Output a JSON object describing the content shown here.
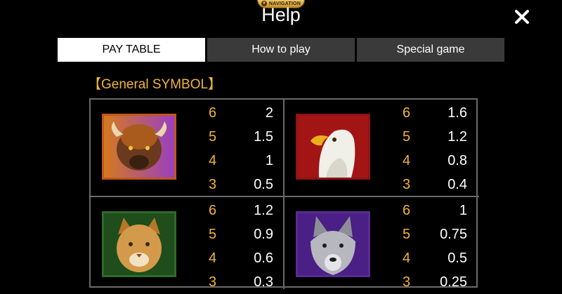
{
  "header": {
    "nav_badge": "NAVIGATION",
    "title": "Help",
    "close_symbol": "✕"
  },
  "tabs": [
    {
      "label": "PAY TABLE",
      "active": true
    },
    {
      "label": "How to play",
      "active": false
    },
    {
      "label": "Special game",
      "active": false
    }
  ],
  "section": {
    "title": "【General SYMBOL】"
  },
  "symbols": [
    {
      "icon": "bison-icon",
      "frame_color": "#c2561c",
      "pays": [
        {
          "count": "6",
          "value": "2"
        },
        {
          "count": "5",
          "value": "1.5"
        },
        {
          "count": "4",
          "value": "1"
        },
        {
          "count": "3",
          "value": "0.5"
        }
      ]
    },
    {
      "icon": "eagle-icon",
      "frame_color": "#8e1414",
      "pays": [
        {
          "count": "6",
          "value": "1.6"
        },
        {
          "count": "5",
          "value": "1.2"
        },
        {
          "count": "4",
          "value": "0.8"
        },
        {
          "count": "3",
          "value": "0.4"
        }
      ]
    },
    {
      "icon": "cougar-icon",
      "frame_color": "#2e6b2a",
      "pays": [
        {
          "count": "6",
          "value": "1.2"
        },
        {
          "count": "5",
          "value": "0.9"
        },
        {
          "count": "4",
          "value": "0.6"
        },
        {
          "count": "3",
          "value": "0.3"
        }
      ]
    },
    {
      "icon": "wolf-icon",
      "frame_color": "#5a2b8f",
      "pays": [
        {
          "count": "6",
          "value": "1"
        },
        {
          "count": "5",
          "value": "0.75"
        },
        {
          "count": "4",
          "value": "0.5"
        },
        {
          "count": "3",
          "value": "0.25"
        }
      ]
    }
  ]
}
